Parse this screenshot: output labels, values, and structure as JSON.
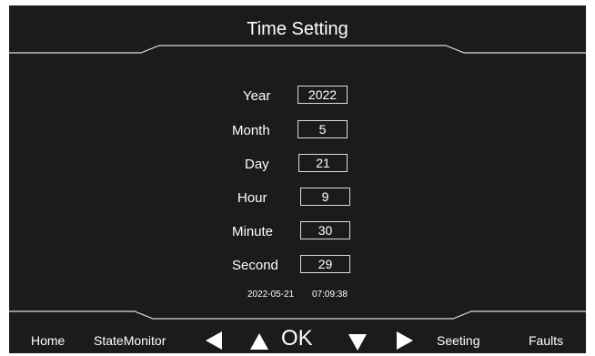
{
  "title": "Time Setting",
  "fields": {
    "year": {
      "label": "Year",
      "value": "2022"
    },
    "month": {
      "label": "Month",
      "value": "5"
    },
    "day": {
      "label": "Day",
      "value": "21"
    },
    "hour": {
      "label": "Hour",
      "value": "9"
    },
    "minute": {
      "label": "Minute",
      "value": "30"
    },
    "second": {
      "label": "Second",
      "value": "29"
    }
  },
  "current": {
    "date": "2022-05-21",
    "time": "07:09:38"
  },
  "nav": {
    "home": "Home",
    "state_monitor": "StateMonitor",
    "ok": "OK",
    "seeting": "Seeting",
    "faults": "Faults",
    "arrows": [
      "left-arrow-icon",
      "up-arrow-icon",
      "down-arrow-icon",
      "right-arrow-icon"
    ]
  },
  "colors": {
    "screen_bg": "#1b1b1b",
    "text": "#ffffff",
    "line": "#dcdcdc"
  }
}
